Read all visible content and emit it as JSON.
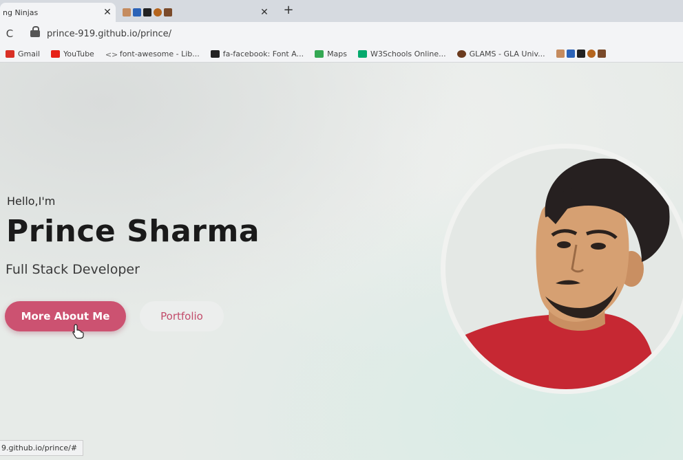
{
  "browser": {
    "tabs": [
      {
        "title": "ng Ninjas",
        "active": true
      },
      {
        "title": "",
        "active": false
      }
    ],
    "url": "prince-919.github.io/prince/",
    "bookmarks": [
      {
        "label": "Gmail",
        "icon": "gmail-icon",
        "color": "#d93025"
      },
      {
        "label": "YouTube",
        "icon": "youtube-icon",
        "color": "#e62117"
      },
      {
        "label": "font-awesome - Lib...",
        "icon": "code-icon",
        "color": "#666666"
      },
      {
        "label": "fa-facebook: Font A...",
        "icon": "image-icon",
        "color": "#222222"
      },
      {
        "label": "Maps",
        "icon": "maps-icon",
        "color": "#34a853"
      },
      {
        "label": "W3Schools Online...",
        "icon": "w3schools-icon",
        "color": "#04aa6d"
      },
      {
        "label": "GLAMS - GLA Univ...",
        "icon": "glams-icon",
        "color": "#6b3b1e"
      }
    ],
    "status_url": "9.github.io/prince/#"
  },
  "hero": {
    "greeting": "Hello,I'm",
    "name": "Prince Sharma",
    "role": "Full Stack Developer",
    "primary_button": "More About Me",
    "secondary_button": "Portfolio"
  },
  "colors": {
    "accent": "#cc5271",
    "shirt": "#c62833"
  }
}
